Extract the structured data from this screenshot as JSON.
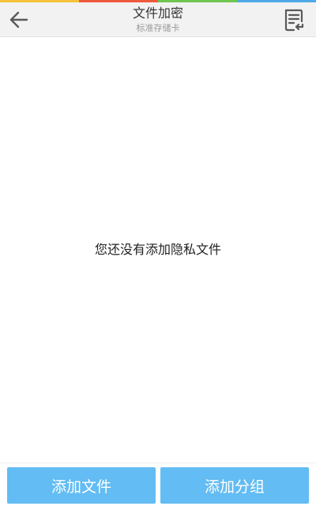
{
  "header": {
    "title": "文件加密",
    "subtitle": "标准存储卡",
    "back_icon": "arrow-left-icon",
    "menu_icon": "file-list-return-icon"
  },
  "main": {
    "empty_message": "您还没有添加隐私文件"
  },
  "bottom": {
    "add_file_label": "添加文件",
    "add_group_label": "添加分组"
  },
  "colors": {
    "accent_button": "#63bcf3",
    "header_bg": "#f2f2f2",
    "strip": [
      "#f5c33b",
      "#ef5a3c",
      "#6fc64f",
      "#4fa9e8"
    ]
  }
}
